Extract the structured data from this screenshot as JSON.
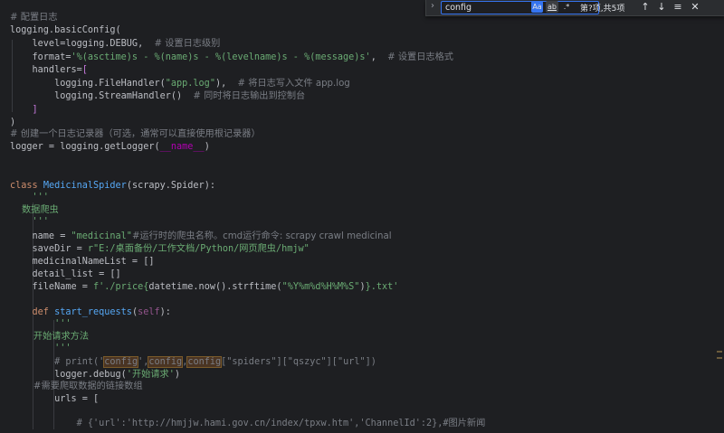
{
  "find_bar": {
    "search_value": "config",
    "opt_match_case": "Aa",
    "opt_whole_word": "ab",
    "opt_regex": ".*",
    "result_text": "第?项,共5项",
    "prev_icon": "arrow-up-icon",
    "next_icon": "arrow-down-icon",
    "select_all_icon": "select-all-icon",
    "close_icon": "close-icon"
  },
  "code": {
    "l1": "# 配置日志",
    "l2_a": "logging.basicConfig(",
    "l3_a": "    level=logging.DEBUG,  ",
    "l3_c": "# 设置日志级别",
    "l4_a": "    format=",
    "l4_s": "'%(asctime)s - %(name)s - %(levelname)s - %(message)s'",
    "l4_b": ",  ",
    "l4_c": "# 设置日志格式",
    "l5_a": "    handlers=",
    "l5_b": "[",
    "l6_a": "        logging.FileHandler(",
    "l6_s": "\"app.log\"",
    "l6_b": "),  ",
    "l6_c": "# 将日志写入文件 app.log",
    "l7_a": "        logging.StreamHandler()  ",
    "l7_c": "# 同时将日志输出到控制台",
    "l8_a": "    ]",
    "l9_a": ")",
    "l10": "# 创建一个日志记录器（可选，通常可以直接使用根记录器）",
    "l11_a": "logger = logging.getLogger(",
    "l11_d": "__name__",
    "l11_b": ")",
    "l14_k": "class ",
    "l14_n": "MedicinalSpider",
    "l14_b": "(scrapy.Spider):",
    "l15": "    '''",
    "l16": "    数据爬虫",
    "l17": "    '''",
    "l18_a": "    name = ",
    "l18_s": "\"medicinal\"",
    "l18_c": "#运行时的爬虫名称。cmd运行命令: scrapy crawl medicinal",
    "l19_a": "    saveDir = ",
    "l19_s": "r\"E:/桌面备份/工作文档/Python/网页爬虫/hmjw\"",
    "l20_a": "    medicinalNameList = []",
    "l21_a": "    detail_list = []",
    "l22_a": "    fileName = ",
    "l22_s1": "f'./price{",
    "l22_m": "datetime.now().strftime(",
    "l22_s2": "\"%Y%m%d%H%M%S\"",
    "l22_m2": ")",
    "l22_s3": "}.txt'",
    "l24_k": "    def ",
    "l24_n": "start_requests",
    "l24_b": "(",
    "l24_self": "self",
    "l24_e": "):",
    "l25": "        '''",
    "l26": "        开始请求方法",
    "l27": "        '''",
    "l28_c1": "        # print('",
    "l28_m1": "config",
    "l28_c2": "',",
    "l28_m2": "config",
    "l28_c3": ",",
    "l28_m3": "config",
    "l28_c4": "[\"spiders\"][\"qszyc\"][\"url\"])",
    "l29_a": "        logger.debug(",
    "l29_s": "'开始请求'",
    "l29_b": ")",
    "l30": "        #需要爬取数据的链接数组",
    "l31_a": "        urls = [",
    "l33": "            # {'url':'http://hmjjw.hami.gov.cn/index/tpxw.htm','ChannelId':2},#图片新闻"
  }
}
